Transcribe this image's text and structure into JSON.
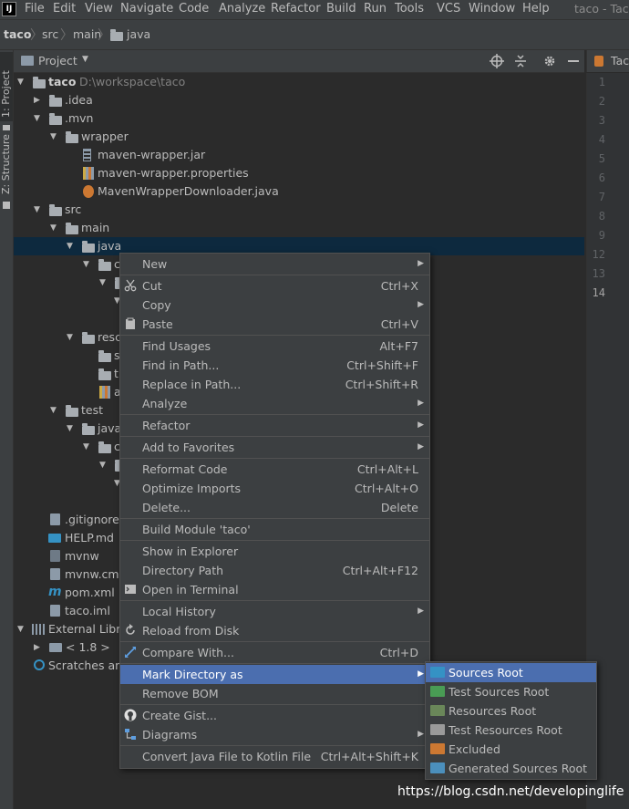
{
  "menubar": {
    "app_icon": "IJ",
    "items": [
      "File",
      "Edit",
      "View",
      "Navigate",
      "Code",
      "Analyze",
      "Refactor",
      "Build",
      "Run",
      "Tools",
      "VCS",
      "Window",
      "Help"
    ],
    "window_title": "taco - Taco"
  },
  "navbar": {
    "crumbs": [
      "taco",
      "src",
      "main",
      "java"
    ]
  },
  "leftstrip": {
    "project": "1: Project",
    "structure": "Z: Structure"
  },
  "project_panel": {
    "title": "Project",
    "dropdown_icon": "chevron-down-icon",
    "tools": [
      "locate-icon",
      "collapse-icon",
      "gear-icon",
      "minimize-icon"
    ]
  },
  "tree": {
    "root": {
      "label": "taco",
      "path": "D:\\workspace\\taco"
    },
    "rows": [
      {
        "label": ".idea"
      },
      {
        "label": ".mvn"
      },
      {
        "label": "wrapper"
      },
      {
        "label": "maven-wrapper.jar"
      },
      {
        "label": "maven-wrapper.properties"
      },
      {
        "label": "MavenWrapperDownloader.java"
      },
      {
        "label": "src"
      },
      {
        "label": "main"
      },
      {
        "label": "java"
      },
      {
        "label": "c"
      },
      {
        "label": "resc"
      },
      {
        "label": "s"
      },
      {
        "label": "t"
      },
      {
        "label": "a"
      },
      {
        "label": "test"
      },
      {
        "label": "java"
      },
      {
        "label": "c"
      },
      {
        "label": ".gitignore"
      },
      {
        "label": "HELP.md"
      },
      {
        "label": "mvnw"
      },
      {
        "label": "mvnw.cmd"
      },
      {
        "label": "pom.xml"
      },
      {
        "label": "taco.iml"
      },
      {
        "label": "External Libra"
      },
      {
        "label": "< 1.8 >"
      },
      {
        "label": "Scratches and"
      }
    ]
  },
  "editor": {
    "tab_label": "Tac",
    "line_numbers": [
      "1",
      "2",
      "3",
      "4",
      "5",
      "6",
      "7",
      "8",
      "9",
      "12",
      "13",
      "14"
    ]
  },
  "context_menu": {
    "items": [
      {
        "label": "New",
        "shortcut": "",
        "submenu": true
      },
      {
        "label": "Cut",
        "shortcut": "Ctrl+X",
        "icon": "scissors-icon"
      },
      {
        "label": "Copy",
        "shortcut": "",
        "submenu": true
      },
      {
        "label": "Paste",
        "shortcut": "Ctrl+V",
        "icon": "clipboard-icon"
      },
      {
        "label": "Find Usages",
        "shortcut": "Alt+F7"
      },
      {
        "label": "Find in Path...",
        "shortcut": "Ctrl+Shift+F"
      },
      {
        "label": "Replace in Path...",
        "shortcut": "Ctrl+Shift+R"
      },
      {
        "label": "Analyze",
        "shortcut": "",
        "submenu": true
      },
      {
        "label": "Refactor",
        "shortcut": "",
        "submenu": true
      },
      {
        "label": "Add to Favorites",
        "shortcut": "",
        "submenu": true
      },
      {
        "label": "Reformat Code",
        "shortcut": "Ctrl+Alt+L"
      },
      {
        "label": "Optimize Imports",
        "shortcut": "Ctrl+Alt+O"
      },
      {
        "label": "Delete...",
        "shortcut": "Delete"
      },
      {
        "label": "Build Module 'taco'",
        "shortcut": ""
      },
      {
        "label": "Show in Explorer",
        "shortcut": ""
      },
      {
        "label": "Directory Path",
        "shortcut": "Ctrl+Alt+F12"
      },
      {
        "label": "Open in Terminal",
        "shortcut": "",
        "icon": "terminal-icon"
      },
      {
        "label": "Local History",
        "shortcut": "",
        "submenu": true
      },
      {
        "label": "Reload from Disk",
        "shortcut": "",
        "icon": "reload-icon"
      },
      {
        "label": "Compare With...",
        "shortcut": "Ctrl+D",
        "icon": "compare-icon"
      },
      {
        "label": "Mark Directory as",
        "shortcut": "",
        "submenu": true
      },
      {
        "label": "Remove BOM",
        "shortcut": ""
      },
      {
        "label": "Create Gist...",
        "shortcut": "",
        "icon": "github-icon"
      },
      {
        "label": "Diagrams",
        "shortcut": "",
        "submenu": true,
        "icon": "diagram-icon"
      },
      {
        "label": "Convert Java File to Kotlin File",
        "shortcut": "Ctrl+Alt+Shift+K"
      }
    ]
  },
  "submenu": {
    "items": [
      {
        "label": "Sources Root",
        "color": "#3592c4"
      },
      {
        "label": "Test Sources Root",
        "color": "#499c54"
      },
      {
        "label": "Resources Root",
        "color": "#6a8759"
      },
      {
        "label": "Test Resources Root",
        "color": "#9a9a9a"
      },
      {
        "label": "Excluded",
        "color": "#cc7832"
      },
      {
        "label": "Generated Sources Root",
        "color": "#4b8fbc"
      }
    ]
  },
  "watermark": "https://blog.csdn.net/developinglife"
}
